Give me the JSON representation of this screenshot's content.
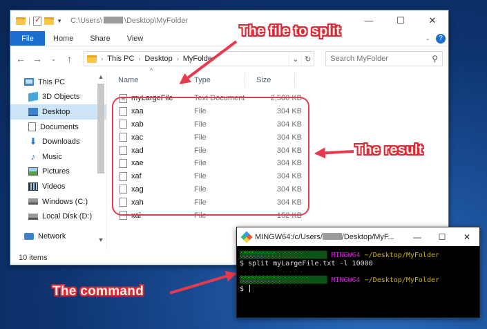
{
  "explorer": {
    "title_prefix": "C:\\Users\\",
    "title_suffix": "\\Desktop\\MyFolder",
    "controls": {
      "minimize": "—",
      "maximize": "☐",
      "close": "✕"
    },
    "ribbon": {
      "file": "File",
      "home": "Home",
      "share": "Share",
      "view": "View"
    },
    "address": {
      "crumbs": [
        "This PC",
        "Desktop",
        "MyFolder"
      ],
      "dropdown": "⌄",
      "refresh": "↻"
    },
    "search": {
      "placeholder": "Search MyFolder"
    },
    "nav": [
      {
        "label": "This PC",
        "icon": "pc-icon"
      },
      {
        "label": "3D Objects",
        "icon": "3d-objects-icon"
      },
      {
        "label": "Desktop",
        "icon": "desktop-icon",
        "selected": true
      },
      {
        "label": "Documents",
        "icon": "documents-icon"
      },
      {
        "label": "Downloads",
        "icon": "downloads-icon"
      },
      {
        "label": "Music",
        "icon": "music-icon"
      },
      {
        "label": "Pictures",
        "icon": "pictures-icon"
      },
      {
        "label": "Videos",
        "icon": "videos-icon"
      },
      {
        "label": "Windows (C:)",
        "icon": "drive-icon"
      },
      {
        "label": "Local Disk (D:)",
        "icon": "drive-icon"
      },
      {
        "label": "Network",
        "icon": "network-icon"
      }
    ],
    "columns": {
      "name": "Name",
      "type": "Type",
      "size": "Size"
    },
    "files": [
      {
        "name": "myLargeFile",
        "type": "Text Document",
        "size": "2,580 KB"
      },
      {
        "name": "xaa",
        "type": "File",
        "size": "304 KB"
      },
      {
        "name": "xab",
        "type": "File",
        "size": "304 KB"
      },
      {
        "name": "xac",
        "type": "File",
        "size": "304 KB"
      },
      {
        "name": "xad",
        "type": "File",
        "size": "304 KB"
      },
      {
        "name": "xae",
        "type": "File",
        "size": "304 KB"
      },
      {
        "name": "xaf",
        "type": "File",
        "size": "304 KB"
      },
      {
        "name": "xag",
        "type": "File",
        "size": "304 KB"
      },
      {
        "name": "xah",
        "type": "File",
        "size": "304 KB"
      },
      {
        "name": "xai",
        "type": "File",
        "size": "152 KB"
      }
    ],
    "status": "10 items"
  },
  "annotations": {
    "file_to_split": "The file to split",
    "result": "The result",
    "command": "The command",
    "color": "#d92a38"
  },
  "terminal": {
    "title_prefix": "MINGW64:/c/Users/",
    "title_suffix": "/Desktop/MyF...",
    "controls": {
      "minimize": "—",
      "maximize": "☐",
      "close": "✕"
    },
    "lines": [
      {
        "kind": "prompt",
        "host": "MINGW64",
        "path": "~/Desktop/MyFolder"
      },
      {
        "kind": "command",
        "text": "$ split myLargeFile.txt -l 10000"
      },
      {
        "kind": "blank"
      },
      {
        "kind": "prompt",
        "host": "MINGW64",
        "path": "~/Desktop/MyFolder"
      },
      {
        "kind": "input",
        "text": "$ "
      }
    ]
  }
}
